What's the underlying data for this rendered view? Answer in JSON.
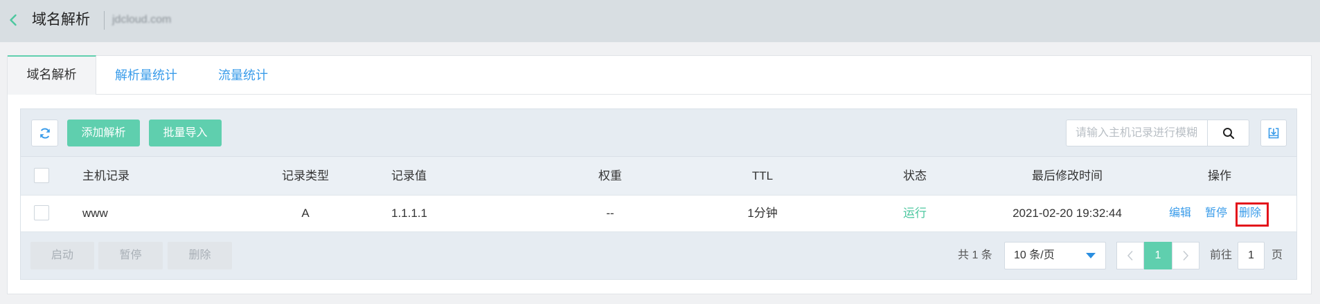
{
  "header": {
    "back_icon": "chevron-left-icon",
    "title": "域名解析",
    "domain": "jdcloud.com"
  },
  "tabs": [
    {
      "label": "域名解析",
      "active": true
    },
    {
      "label": "解析量统计",
      "active": false
    },
    {
      "label": "流量统计",
      "active": false
    }
  ],
  "toolbar": {
    "refresh_icon": "refresh-icon",
    "add_label": "添加解析",
    "import_label": "批量导入",
    "search_placeholder": "请输入主机记录进行模糊",
    "search_icon": "search-icon",
    "export_icon": "download-icon"
  },
  "table": {
    "columns": [
      "主机记录",
      "记录类型",
      "记录值",
      "权重",
      "TTL",
      "状态",
      "最后修改时间",
      "操作"
    ],
    "rows": [
      {
        "selected": false,
        "host": "www",
        "type": "A",
        "value": "1.1.1.1",
        "weight": "--",
        "ttl": "1分钟",
        "status": "运行",
        "modified": "2021-02-20 19:32:44",
        "actions": [
          "编辑",
          "暂停",
          "删除"
        ],
        "highlighted_action_index": 2
      }
    ]
  },
  "footer": {
    "batch_actions": [
      "启动",
      "暂停",
      "删除"
    ],
    "total": "共 1 条",
    "page_size": "10 条/页",
    "page_size_icon": "caret-down-icon",
    "prev_icon": "chevron-left-icon",
    "next_icon": "chevron-right-icon",
    "current_page": "1",
    "goto_label": "前往",
    "goto_value": "1",
    "goto_suffix": "页"
  },
  "colors": {
    "accent": "#5fcfae",
    "link": "#3a9cea",
    "status_running": "#4cc79f",
    "highlight": "#e3131b",
    "dropdown_caret": "#2a8ee0"
  }
}
